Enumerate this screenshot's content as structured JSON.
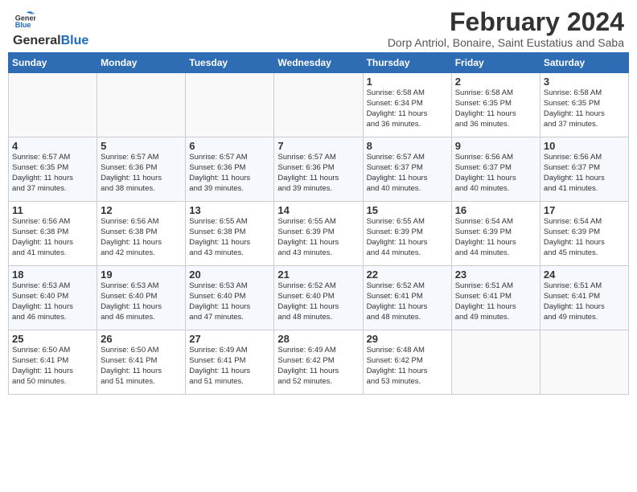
{
  "header": {
    "logo_general": "General",
    "logo_blue": "Blue",
    "title": "February 2024",
    "location": "Dorp Antriol, Bonaire, Saint Eustatius and Saba"
  },
  "weekdays": [
    "Sunday",
    "Monday",
    "Tuesday",
    "Wednesday",
    "Thursday",
    "Friday",
    "Saturday"
  ],
  "weeks": [
    [
      {
        "day": "",
        "info": ""
      },
      {
        "day": "",
        "info": ""
      },
      {
        "day": "",
        "info": ""
      },
      {
        "day": "",
        "info": ""
      },
      {
        "day": "1",
        "info": "Sunrise: 6:58 AM\nSunset: 6:34 PM\nDaylight: 11 hours\nand 36 minutes."
      },
      {
        "day": "2",
        "info": "Sunrise: 6:58 AM\nSunset: 6:35 PM\nDaylight: 11 hours\nand 36 minutes."
      },
      {
        "day": "3",
        "info": "Sunrise: 6:58 AM\nSunset: 6:35 PM\nDaylight: 11 hours\nand 37 minutes."
      }
    ],
    [
      {
        "day": "4",
        "info": "Sunrise: 6:57 AM\nSunset: 6:35 PM\nDaylight: 11 hours\nand 37 minutes."
      },
      {
        "day": "5",
        "info": "Sunrise: 6:57 AM\nSunset: 6:36 PM\nDaylight: 11 hours\nand 38 minutes."
      },
      {
        "day": "6",
        "info": "Sunrise: 6:57 AM\nSunset: 6:36 PM\nDaylight: 11 hours\nand 39 minutes."
      },
      {
        "day": "7",
        "info": "Sunrise: 6:57 AM\nSunset: 6:36 PM\nDaylight: 11 hours\nand 39 minutes."
      },
      {
        "day": "8",
        "info": "Sunrise: 6:57 AM\nSunset: 6:37 PM\nDaylight: 11 hours\nand 40 minutes."
      },
      {
        "day": "9",
        "info": "Sunrise: 6:56 AM\nSunset: 6:37 PM\nDaylight: 11 hours\nand 40 minutes."
      },
      {
        "day": "10",
        "info": "Sunrise: 6:56 AM\nSunset: 6:37 PM\nDaylight: 11 hours\nand 41 minutes."
      }
    ],
    [
      {
        "day": "11",
        "info": "Sunrise: 6:56 AM\nSunset: 6:38 PM\nDaylight: 11 hours\nand 41 minutes."
      },
      {
        "day": "12",
        "info": "Sunrise: 6:56 AM\nSunset: 6:38 PM\nDaylight: 11 hours\nand 42 minutes."
      },
      {
        "day": "13",
        "info": "Sunrise: 6:55 AM\nSunset: 6:38 PM\nDaylight: 11 hours\nand 43 minutes."
      },
      {
        "day": "14",
        "info": "Sunrise: 6:55 AM\nSunset: 6:39 PM\nDaylight: 11 hours\nand 43 minutes."
      },
      {
        "day": "15",
        "info": "Sunrise: 6:55 AM\nSunset: 6:39 PM\nDaylight: 11 hours\nand 44 minutes."
      },
      {
        "day": "16",
        "info": "Sunrise: 6:54 AM\nSunset: 6:39 PM\nDaylight: 11 hours\nand 44 minutes."
      },
      {
        "day": "17",
        "info": "Sunrise: 6:54 AM\nSunset: 6:39 PM\nDaylight: 11 hours\nand 45 minutes."
      }
    ],
    [
      {
        "day": "18",
        "info": "Sunrise: 6:53 AM\nSunset: 6:40 PM\nDaylight: 11 hours\nand 46 minutes."
      },
      {
        "day": "19",
        "info": "Sunrise: 6:53 AM\nSunset: 6:40 PM\nDaylight: 11 hours\nand 46 minutes."
      },
      {
        "day": "20",
        "info": "Sunrise: 6:53 AM\nSunset: 6:40 PM\nDaylight: 11 hours\nand 47 minutes."
      },
      {
        "day": "21",
        "info": "Sunrise: 6:52 AM\nSunset: 6:40 PM\nDaylight: 11 hours\nand 48 minutes."
      },
      {
        "day": "22",
        "info": "Sunrise: 6:52 AM\nSunset: 6:41 PM\nDaylight: 11 hours\nand 48 minutes."
      },
      {
        "day": "23",
        "info": "Sunrise: 6:51 AM\nSunset: 6:41 PM\nDaylight: 11 hours\nand 49 minutes."
      },
      {
        "day": "24",
        "info": "Sunrise: 6:51 AM\nSunset: 6:41 PM\nDaylight: 11 hours\nand 49 minutes."
      }
    ],
    [
      {
        "day": "25",
        "info": "Sunrise: 6:50 AM\nSunset: 6:41 PM\nDaylight: 11 hours\nand 50 minutes."
      },
      {
        "day": "26",
        "info": "Sunrise: 6:50 AM\nSunset: 6:41 PM\nDaylight: 11 hours\nand 51 minutes."
      },
      {
        "day": "27",
        "info": "Sunrise: 6:49 AM\nSunset: 6:41 PM\nDaylight: 11 hours\nand 51 minutes."
      },
      {
        "day": "28",
        "info": "Sunrise: 6:49 AM\nSunset: 6:42 PM\nDaylight: 11 hours\nand 52 minutes."
      },
      {
        "day": "29",
        "info": "Sunrise: 6:48 AM\nSunset: 6:42 PM\nDaylight: 11 hours\nand 53 minutes."
      },
      {
        "day": "",
        "info": ""
      },
      {
        "day": "",
        "info": ""
      }
    ]
  ]
}
